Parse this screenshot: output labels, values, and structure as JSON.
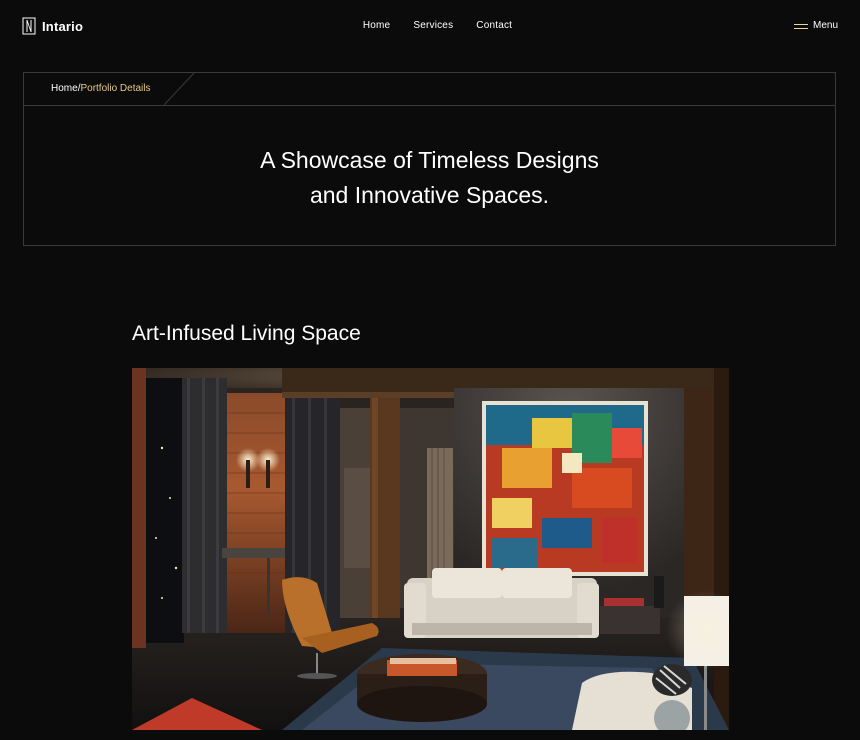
{
  "header": {
    "logo_text": "Intario",
    "nav": [
      {
        "label": "Home"
      },
      {
        "label": "Services"
      },
      {
        "label": "Contact"
      }
    ],
    "menu_label": "Menu"
  },
  "breadcrumb": {
    "home": "Home",
    "separator": "/",
    "current": "Portfolio Details"
  },
  "hero": {
    "title_line1": "A Showcase of Timeless Designs",
    "title_line2": "and Innovative Spaces."
  },
  "project": {
    "title": "Art-Infused Living Space"
  },
  "colors": {
    "background": "#0b0b0b",
    "accent": "#e6c98a",
    "border": "#3a3a3a"
  },
  "icons": {
    "logo": "logo-mark-icon",
    "menu": "hamburger-icon"
  }
}
